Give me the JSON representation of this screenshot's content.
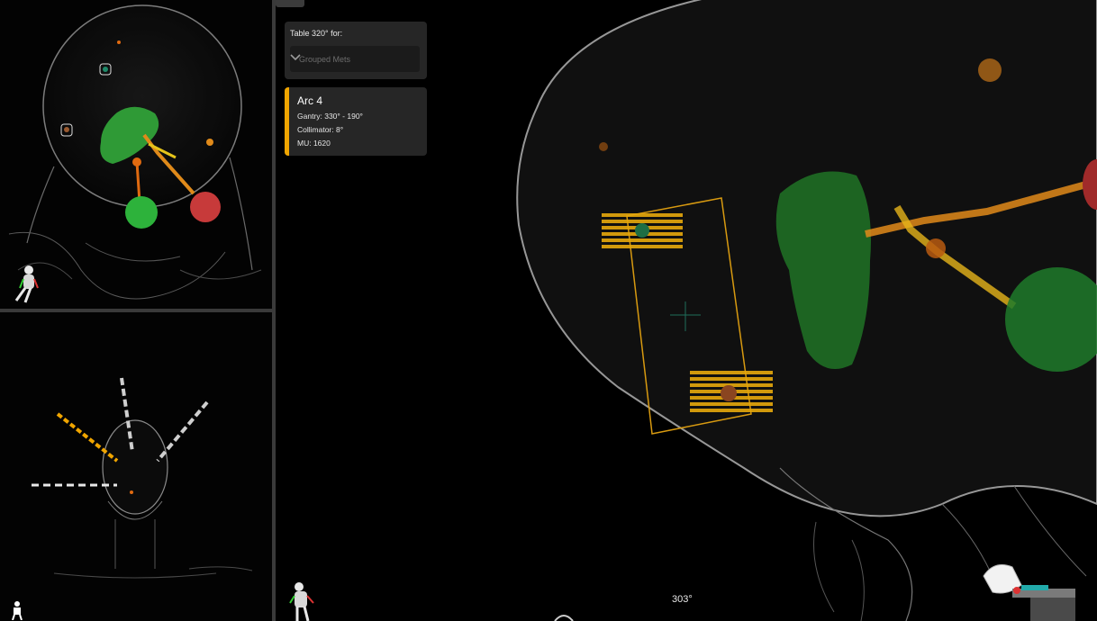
{
  "table_panel": {
    "label": "Table 320° for:",
    "dropdown_value": "Grouped Mets",
    "chevron_icon": "chevron-down-icon"
  },
  "arc": {
    "title": "Arc 4",
    "gantry": "Gantry: 330° - 190°",
    "collimator": "Collimator: 8°",
    "mu": "MU: 1620",
    "accent_color": "#f0a500"
  },
  "main_view": {
    "gantry_angle": "303°"
  },
  "colors": {
    "accent": "#f0a500",
    "target_green": "#2ea83a",
    "target_red": "#c73a3a",
    "organ_green": "#1f6e25",
    "trajectory_orange": "#e08a1a",
    "skull_outline": "#9a9a9a"
  },
  "icons": [
    "person-orientation-icon",
    "chevron-down-icon",
    "linac-gantry-icon",
    "crosshair-icon"
  ]
}
